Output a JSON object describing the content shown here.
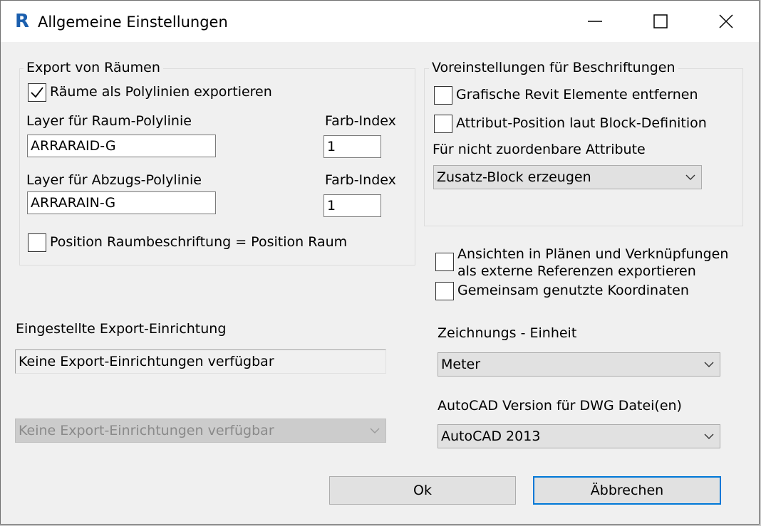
{
  "window": {
    "title": "Allgemeine Einstellungen",
    "app_icon_letter": "R"
  },
  "rooms_group": {
    "legend": "Export von Räumen",
    "export_polylines": {
      "label": "Räume als Polylinien exportieren",
      "checked": true
    },
    "room_layer": {
      "label": "Layer für Raum-Polylinie",
      "value": "ARRARAID-G"
    },
    "room_color": {
      "label": "Farb-Index",
      "value": "1"
    },
    "deduct_layer": {
      "label": "Layer für Abzugs-Polylinie",
      "value": "ARRARAIN-G"
    },
    "deduct_color": {
      "label": "Farb-Index",
      "value": "1"
    },
    "label_position": {
      "label": "Position Raumbeschriftung = Position Raum",
      "checked": false
    }
  },
  "annotation_group": {
    "legend": "Voreinstellungen für Beschriftungen",
    "remove_graphics": {
      "label": "Grafische Revit Elemente entfernen",
      "checked": false
    },
    "attribute_position": {
      "label": "Attribut-Position laut Block-Definition",
      "checked": false
    },
    "unassignable_label": "Für nicht zuordenbare Attribute",
    "unassignable_value": "Zusatz-Block erzeugen"
  },
  "xref": {
    "label_line1": "Ansichten in Plänen und Verknüpfungen",
    "label_line2": "als externe Referenzen exportieren",
    "checked": false
  },
  "shared_coords": {
    "label": "Gemeinsam genutzte Koordinaten",
    "checked": false
  },
  "export_setup": {
    "label": "Eingestellte Export-Einrichtung",
    "value": "Keine Export-Einrichtungen verfügbar",
    "combo_value": "Keine Export-Einrichtungen verfügbar"
  },
  "units": {
    "label": "Zeichnungs - Einheit",
    "value": "Meter"
  },
  "autocad_version": {
    "label": "AutoCAD Version für DWG Datei(en)",
    "value": "AutoCAD 2013"
  },
  "buttons": {
    "ok": "Ok",
    "cancel": "Äbbrechen"
  },
  "colors": {
    "accent": "#0078d7",
    "revit_blue": "#1b5fae",
    "dialog_bg": "#f0f0f0"
  }
}
